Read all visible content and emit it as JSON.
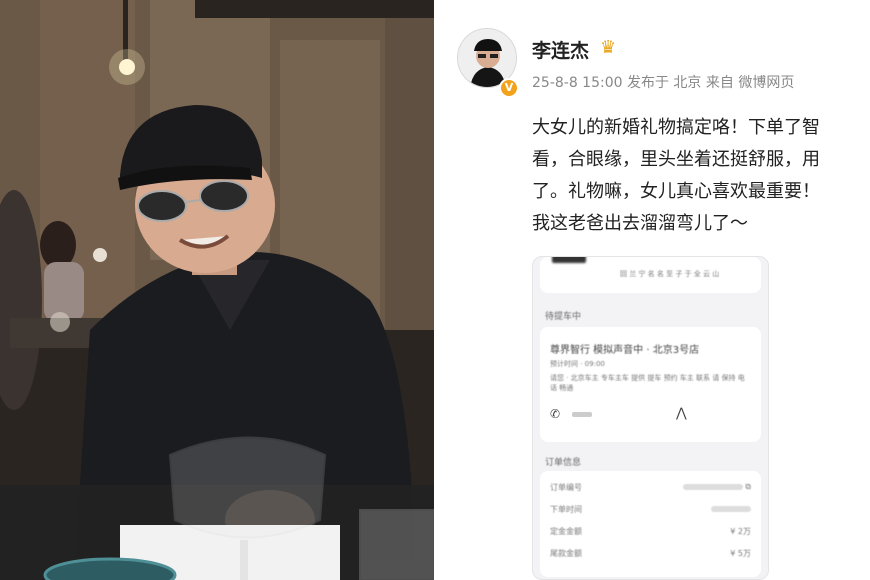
{
  "post": {
    "username": "李连杰",
    "crown_icon": "crown-icon",
    "verified_badge": "V",
    "meta": "25-8-8 15:00  发布于 北京  来自 微博网页",
    "body_lines": [
      "大女儿的新婚礼物搞定咯！下单了智",
      "看，合眼缘，里头坐着还挺舒服，用",
      "了。礼物嘛，女儿真心喜欢最重要！",
      "我这老爸出去溜溜弯儿了～"
    ]
  },
  "screenshot": {
    "top_line": "回 兰 宁 名 名 至 子 于 全 云 山",
    "section1_label": "待提车中",
    "card_title": "尊界智行 模拟声音中 · 北京3号店",
    "card_sub": "预计时间 · 09:00",
    "card_desc": "请您 · 北京车主 专车主车 提供 提车 预约 车主 联系 请 保持 电话 畅通",
    "section2_label": "订单信息",
    "rows": [
      {
        "k": "订单编号",
        "v": ""
      },
      {
        "k": "下单时间",
        "v": ""
      },
      {
        "k": "定金金额",
        "v": "¥ 2万"
      },
      {
        "k": "尾款金额",
        "v": "¥ 5万"
      }
    ],
    "accent": "#f3a21b"
  }
}
